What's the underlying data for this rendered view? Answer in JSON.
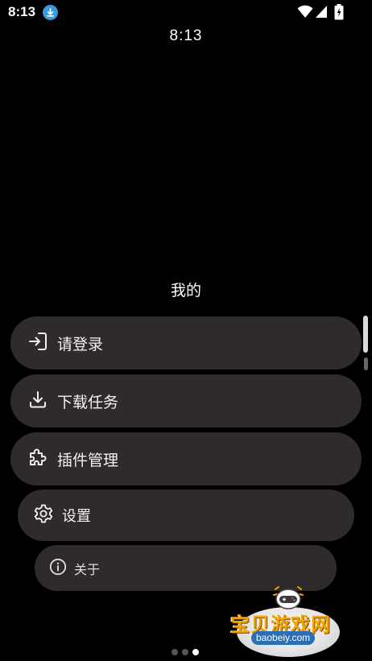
{
  "status_bar": {
    "time": "8:13",
    "download_icon": "download-notification-icon",
    "wifi_icon": "wifi-icon",
    "signal_icon": "cell-signal-icon",
    "battery_icon": "battery-charging-icon"
  },
  "clock": "8:13",
  "page": {
    "title": "我的"
  },
  "menu": {
    "login": {
      "label": "请登录",
      "icon": "login-icon"
    },
    "download": {
      "label": "下载任务",
      "icon": "download-icon"
    },
    "plugins": {
      "label": "插件管理",
      "icon": "puzzle-piece-icon"
    },
    "settings": {
      "label": "设置",
      "icon": "gear-icon"
    },
    "about": {
      "label": "关于",
      "icon": "info-icon"
    }
  },
  "pager": {
    "count": 3,
    "active_index": 2
  },
  "watermark": {
    "text": "宝贝游戏网",
    "url": "baobeiy.com"
  },
  "colors": {
    "background": "#000000",
    "chip": "#2f2b2c",
    "accent_blue": "#3a9bdc",
    "watermark_orange": "#f5a400"
  }
}
